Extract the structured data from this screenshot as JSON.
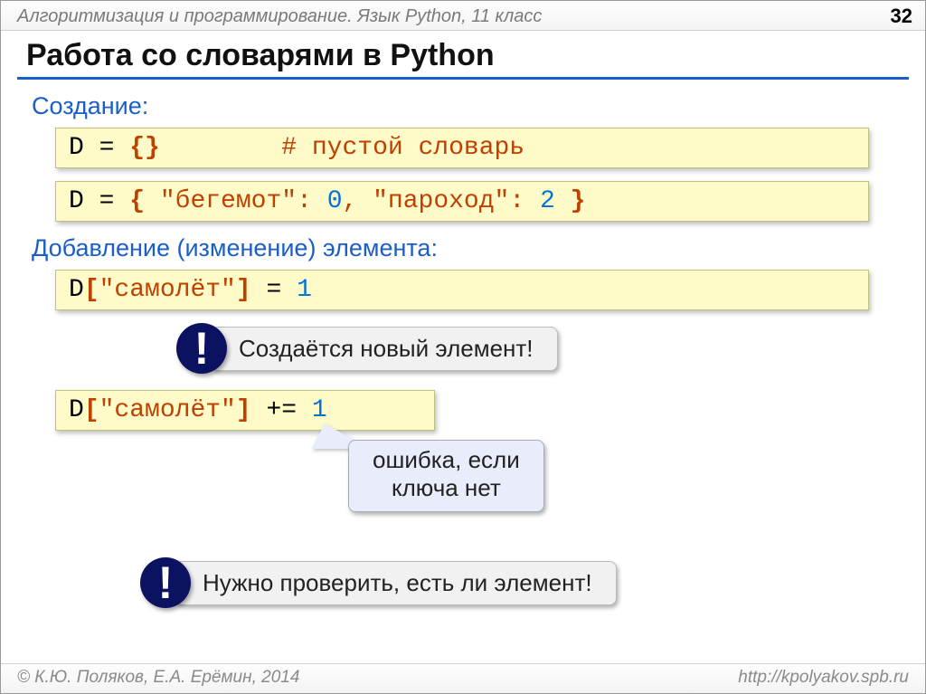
{
  "header": {
    "course": "Алгоритмизация и программирование. Язык Python, 11 класс",
    "page": "32"
  },
  "title": "Работа со словарями в Python",
  "sections": {
    "create": "Создание:",
    "add": "Добавление (изменение) элемента:"
  },
  "code": {
    "box1": {
      "d": "D",
      "eq": " = ",
      "braces": "{}",
      "pad": "        ",
      "comment": "# пустой словарь"
    },
    "box2": {
      "d": "D",
      "eq": " = ",
      "open": "{ ",
      "str1": "\"бегемот\"",
      "colon1": ": ",
      "num1": "0",
      "comma": ", ",
      "str2": "\"пароход\"",
      "colon2": ": ",
      "num2": "2",
      "close": " }"
    },
    "box3": {
      "d": "D",
      "lbr": "[",
      "str": "\"самолёт\"",
      "rbr": "]",
      "eq": " = ",
      "num": "1"
    },
    "box4": {
      "d": "D",
      "lbr": "[",
      "str": "\"самолёт\"",
      "rbr": "]",
      "pluseq": " += ",
      "num": "1"
    }
  },
  "callouts": {
    "exclaim": "!",
    "new_element": "Создаётся новый элемент!",
    "check_needed": "Нужно проверить, есть ли элемент!",
    "error_line1": "ошибка, если",
    "error_line2": "ключа нет"
  },
  "footer": {
    "copyright": "© К.Ю. Поляков, Е.А. Ерёмин, 2014",
    "url": "http://kpolyakov.spb.ru"
  }
}
